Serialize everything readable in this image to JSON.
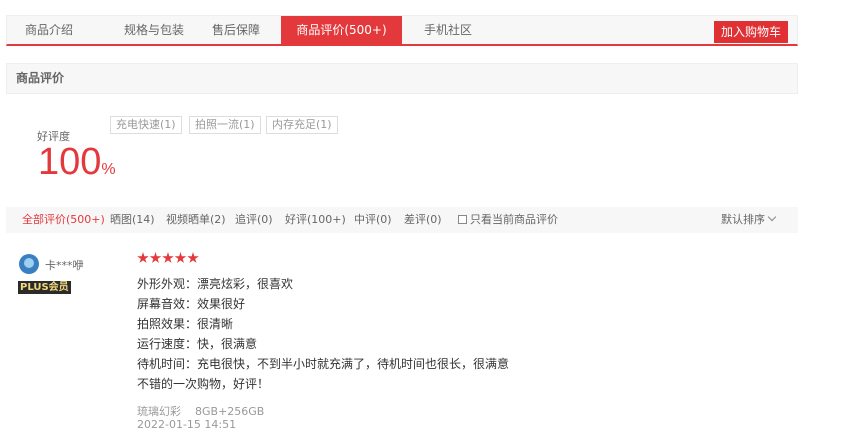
{
  "tabs": [
    "商品介绍",
    "规格与包装",
    "售后保障",
    "商品评价(500+)",
    "手机社区"
  ],
  "active_tab": "商品评价(500+)",
  "cart_button": "加入购物车",
  "section_title": "商品评价",
  "rating": {
    "label": "好评度",
    "value": "100",
    "unit": "%"
  },
  "tags": [
    "充电快速(1)",
    "拍照一流(1)",
    "内存充足(1)"
  ],
  "filters": [
    "全部评价(500+)",
    "晒图(14)",
    "视频晒单(2)",
    "追评(0)",
    "好评(100+)",
    "中评(0)",
    "差评(0)"
  ],
  "only_current_label": "只看当前商品评价",
  "sort_label": "默认排序",
  "review": {
    "username": "卡***咿",
    "badge": "PLUS会员",
    "stars": 5,
    "lines": [
      "外形外观：漂亮炫彩，很喜欢",
      "屏幕音效：效果很好",
      "拍照效果：很清晰",
      "运行速度：快，很满意",
      "待机时间：充电很快，不到半小时就充满了，待机时间也很长，很满意",
      "不错的一次购物，好评！"
    ],
    "color": "琉璃幻彩",
    "spec": "8GB+256GB",
    "date": "2022-01-15 14:51"
  },
  "colors": {
    "accent": "#e4393c",
    "badge_bg": "#2b2b2b",
    "badge_text": "#f0d87a"
  }
}
